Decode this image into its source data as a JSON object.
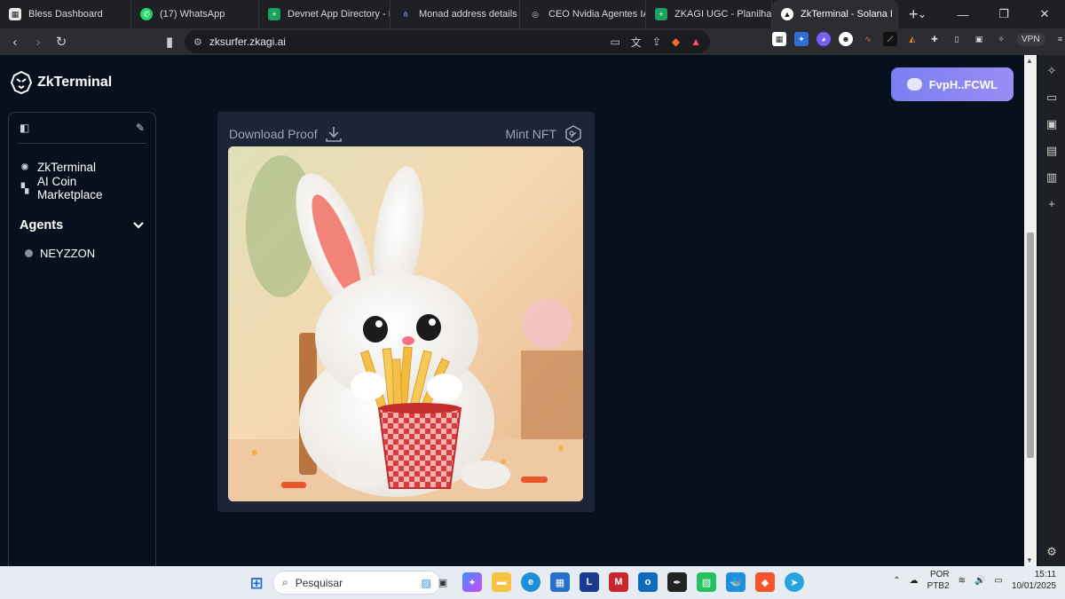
{
  "browser": {
    "tabs": [
      {
        "title": "Bless Dashboard",
        "icon": "bless-icon",
        "color": "#e8e8e8"
      },
      {
        "title": "(17) WhatsApp",
        "icon": "whatsapp-icon",
        "color": "#25d366"
      },
      {
        "title": "Devnet App Directory - Pl",
        "icon": "sheets-icon",
        "color": "#1aa260"
      },
      {
        "title": "Monad address details fo",
        "icon": "monad-icon",
        "color": "#3d5bd9"
      },
      {
        "title": "CEO Nvidia Agentes IA",
        "icon": "globe-icon",
        "color": "#888"
      },
      {
        "title": "ZKAGI UGC - Planilhas Go",
        "icon": "sheets-icon",
        "color": "#1aa260"
      },
      {
        "title": "ZkTerminal - Solana I",
        "icon": "zkterminal-icon",
        "color": "#111"
      }
    ],
    "url": "zksurfer.zkagi.ai",
    "vpn_label": "VPN"
  },
  "app": {
    "logo_text": "ZkTerminal",
    "wallet_label": "FvpH..FCWL",
    "sidebar": {
      "items": [
        {
          "label": "ZkTerminal",
          "icon": "zkterminal-icon"
        },
        {
          "label": "AI Coin Marketplace",
          "icon": "grid-icon"
        }
      ],
      "agents_heading": "Agents",
      "agents": [
        {
          "label": "NEYZZON"
        }
      ]
    },
    "card": {
      "download_label": "Download Proof",
      "mint_label": "Mint NFT",
      "image_alt": "white bunny eating french fries from a checkered cup"
    }
  },
  "taskbar": {
    "search_placeholder": "Pesquisar",
    "lang_top": "POR",
    "lang_bottom": "PTB2",
    "time": "15:11",
    "date": "10/01/2025"
  }
}
